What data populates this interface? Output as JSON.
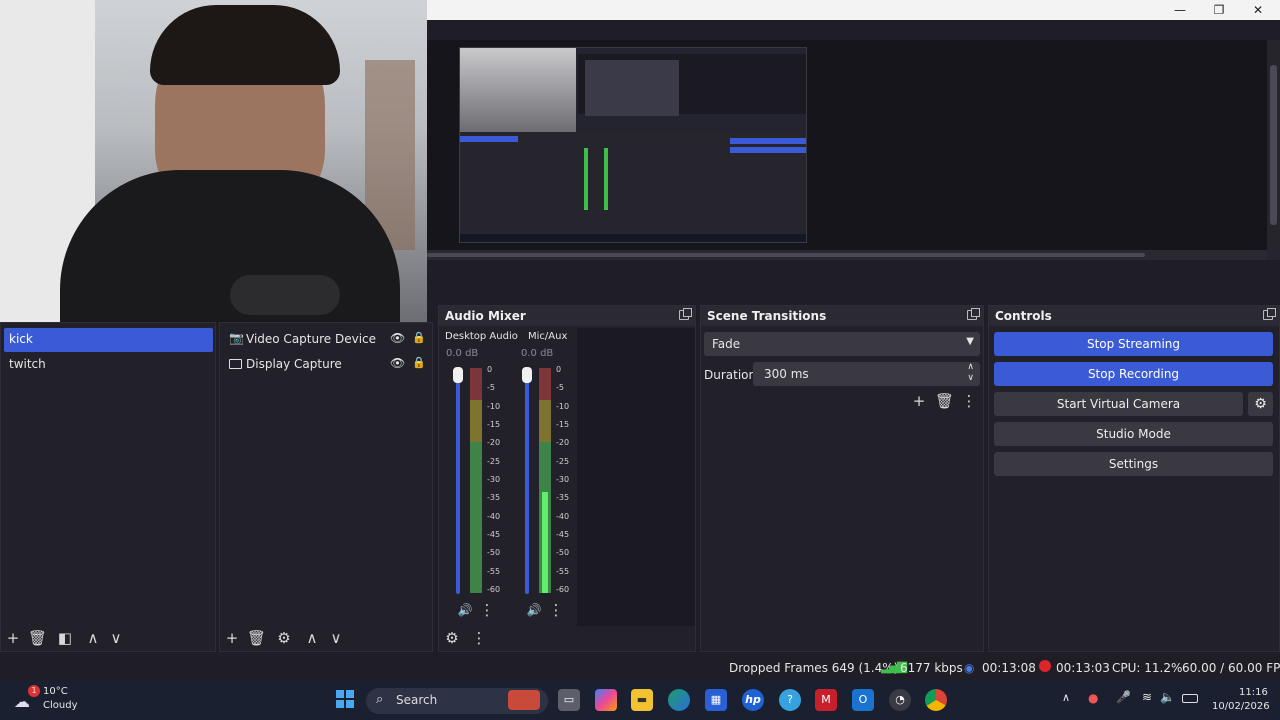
{
  "window_controls": {
    "minimize": "—",
    "maximize": "❐",
    "close": "✕"
  },
  "scenes": {
    "items": [
      {
        "label": "kick",
        "selected": true
      },
      {
        "label": "twitch",
        "selected": false
      }
    ]
  },
  "sources": {
    "items": [
      {
        "label": "Video Capture Device",
        "icon": "camera-icon"
      },
      {
        "label": "Display Capture",
        "icon": "monitor-icon"
      }
    ]
  },
  "audio_mixer": {
    "title": "Audio Mixer",
    "channels": [
      {
        "name": "Desktop Audio",
        "db": "0.0 dB",
        "volume": 1.0,
        "level": 0.0
      },
      {
        "name": "Mic/Aux",
        "db": "0.0 dB",
        "volume": 1.0,
        "level": 0.45
      }
    ],
    "ticks": [
      "0",
      "-5",
      "-10",
      "-15",
      "-20",
      "-25",
      "-30",
      "-35",
      "-40",
      "-45",
      "-50",
      "-55",
      "-60"
    ]
  },
  "scene_transitions": {
    "title": "Scene Transitions",
    "selected": "Fade",
    "duration_label": "Duration",
    "duration_value": "300 ms"
  },
  "controls": {
    "title": "Controls",
    "stop_streaming": "Stop Streaming",
    "stop_recording": "Stop Recording",
    "start_virtual_camera": "Start Virtual Camera",
    "studio_mode": "Studio Mode",
    "settings": "Settings"
  },
  "status": {
    "dropped_frames": "Dropped Frames 649 (1.4%)",
    "bitrate": "6177 kbps",
    "stream_time": "00:13:08",
    "record_time": "00:13:03",
    "cpu": "CPU: 11.2%",
    "fps": "60.00 / 60.00 FPS"
  },
  "taskbar": {
    "weather_temp": "10°C",
    "weather_desc": "Cloudy",
    "weather_badge": "1",
    "search_placeholder": "Search",
    "time": "11:16",
    "date": "10/02/2026"
  },
  "colors": {
    "accent": "#3b5ad6",
    "meter_green": "#3fbf4a",
    "meter_yellow": "#b7a31e",
    "meter_red": "#b0302f",
    "record_red": "#e0242b"
  }
}
